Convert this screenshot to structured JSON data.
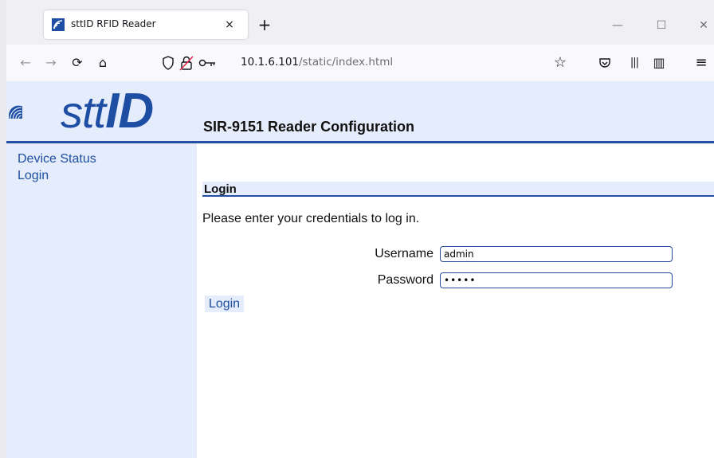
{
  "browser": {
    "tab_title": "sttID RFID Reader",
    "tab_close": "×",
    "new_tab": "+",
    "url_host": "10.1.6.101",
    "url_path": "/static/index.html",
    "window_controls": {
      "minimize": "—",
      "maximize": "☐",
      "close": "✕"
    },
    "nav_icons": {
      "back": "←",
      "forward": "→",
      "reload": "⟳",
      "home": "⌂",
      "bookmark": "☆",
      "menu": "≡",
      "library": "|||",
      "sidebar": "▥"
    }
  },
  "header": {
    "logo_prefix": "stt",
    "logo_suffix": "ID",
    "title": "SIR-9151 Reader Configuration"
  },
  "sidebar": {
    "items": [
      {
        "label": "Device Status"
      },
      {
        "label": "Login"
      }
    ]
  },
  "main": {
    "section_title": "Login",
    "intro": "Please enter your credentials to log in.",
    "username_label": "Username",
    "username_value": "admin",
    "password_label": "Password",
    "password_value": "admin",
    "submit_label": "Login"
  },
  "colors": {
    "brand_blue": "#1d4ea4",
    "panel_bg": "#e5ecfc",
    "rule_blue": "#244fa3"
  }
}
